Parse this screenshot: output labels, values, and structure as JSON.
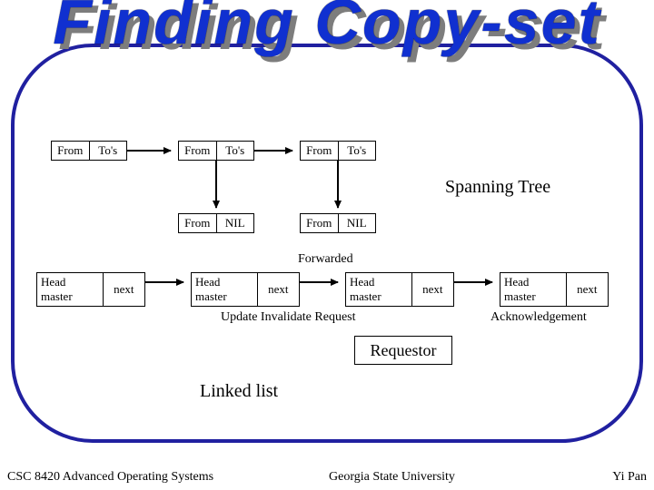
{
  "title": "Finding Copy-set",
  "tree": {
    "row1": [
      {
        "l": "From",
        "r": "To's"
      },
      {
        "l": "From",
        "r": "To's"
      },
      {
        "l": "From",
        "r": "To's"
      }
    ],
    "row2": [
      {
        "l": "From",
        "r": "NIL"
      },
      {
        "l": "From",
        "r": "NIL"
      }
    ],
    "label": "Spanning Tree"
  },
  "list": {
    "boxes": [
      {
        "l": "Head master",
        "r": "next"
      },
      {
        "l": "Head master",
        "r": "next"
      },
      {
        "l": "Head master",
        "r": "next"
      },
      {
        "l": "Head master",
        "r": "next"
      }
    ],
    "forwarded": "Forwarded",
    "update": "Update Invalidate Request",
    "ack": "Acknowledgement",
    "requestor": "Requestor",
    "caption": "Linked list"
  },
  "footer": {
    "left": "CSC 8420 Advanced Operating Systems",
    "center": "Georgia State University",
    "right": "Yi Pan"
  }
}
